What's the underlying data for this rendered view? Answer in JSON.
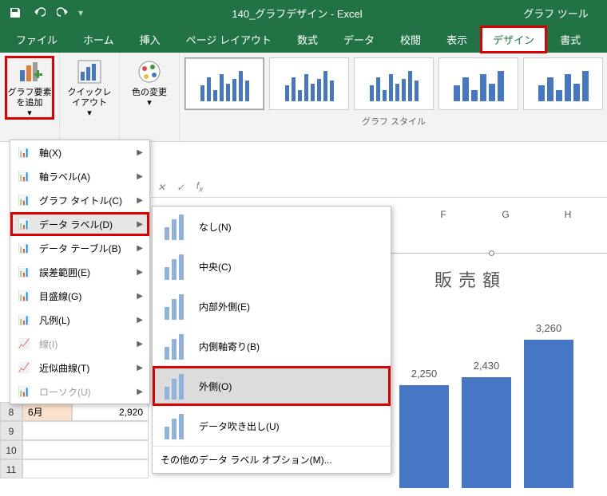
{
  "window": {
    "title": "140_グラフデザイン - Excel",
    "tool_tab": "グラフ ツール"
  },
  "qat": {
    "save": "save",
    "undo": "undo",
    "redo": "redo"
  },
  "tabs": [
    "ファイル",
    "ホーム",
    "挿入",
    "ページ レイアウト",
    "数式",
    "データ",
    "校閲",
    "表示",
    "デザイン",
    "書式"
  ],
  "ribbon": {
    "add_element": "グラフ要素を追加",
    "quick_layout": "クイックレイアウト",
    "change_colors": "色の変更",
    "styles_label": "グラフ スタイル"
  },
  "menu1": {
    "axes": "軸(X)",
    "axis_titles": "軸ラベル(A)",
    "chart_title": "グラフ タイトル(C)",
    "data_labels": "データ ラベル(D)",
    "data_table": "データ テーブル(B)",
    "error_bars": "誤差範囲(E)",
    "gridlines": "目盛線(G)",
    "legend": "凡例(L)",
    "lines": "線(I)",
    "trendline": "近似曲線(T)",
    "updown_bars": "ローソク(U)"
  },
  "menu2": {
    "none": "なし(N)",
    "center": "中央(C)",
    "inside_end": "内部外側(E)",
    "inside_base": "内側軸寄り(B)",
    "outside_end": "外側(O)",
    "callout": "データ吹き出し(U)",
    "more": "その他のデータ ラベル オプション(M)..."
  },
  "sheet": {
    "cols": [
      "F",
      "G",
      "H"
    ],
    "left_header_row": "8",
    "month": "6月",
    "value": "2,920",
    "rows_after": [
      "9",
      "10",
      "11"
    ]
  },
  "chart": {
    "title": "販売額"
  },
  "chart_data": {
    "type": "bar",
    "title": "販売額",
    "categories": [
      "(col F)",
      "(col G)",
      "(col H)"
    ],
    "values": [
      2250,
      2430,
      3260
    ],
    "ylim": [
      0,
      3500
    ],
    "data_labels": "outside_end"
  }
}
